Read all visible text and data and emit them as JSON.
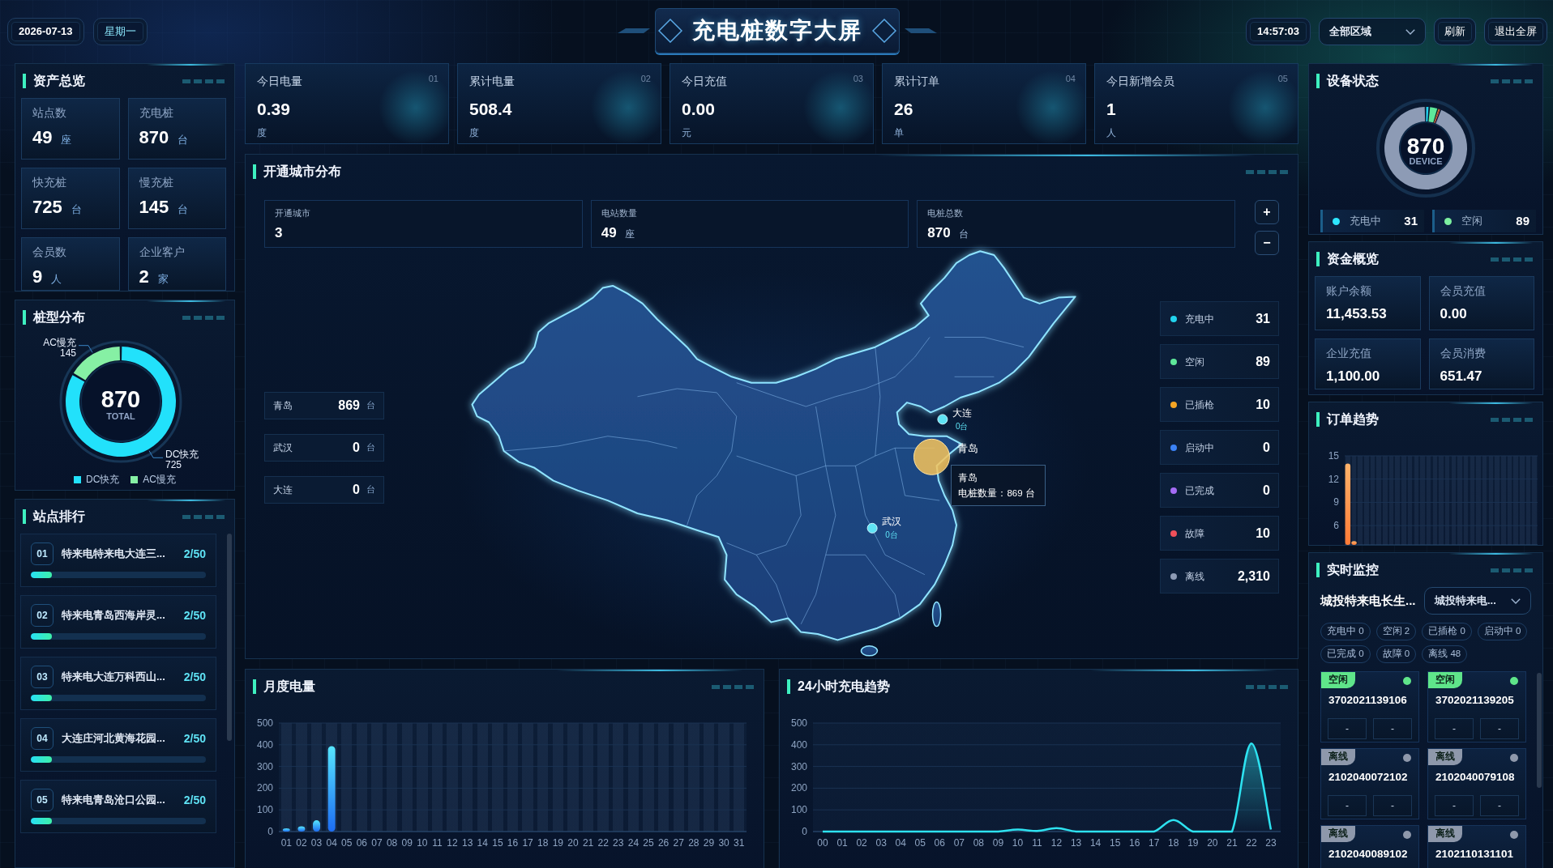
{
  "header": {
    "date": "2026-07-13",
    "weekday": "星期一",
    "title": "充电桩数字大屏",
    "time": "14:57:03",
    "region_select": "全部区域",
    "buttons": [
      "刷新",
      "退出全屏"
    ]
  },
  "asset_overview": {
    "title": "资产总览",
    "items": [
      {
        "label": "站点数",
        "value": "49",
        "unit": "座"
      },
      {
        "label": "充电桩",
        "value": "870",
        "unit": "台"
      },
      {
        "label": "快充桩",
        "value": "725",
        "unit": "台"
      },
      {
        "label": "慢充桩",
        "value": "145",
        "unit": "台"
      },
      {
        "label": "会员数",
        "value": "9",
        "unit": "人"
      },
      {
        "label": "企业客户",
        "value": "2",
        "unit": "家"
      }
    ]
  },
  "pile_types": {
    "title": "桩型分布",
    "total": "870",
    "total_label": "TOTAL",
    "chart_data": {
      "type": "donut",
      "categories": [
        "DC快充",
        "AC慢充"
      ],
      "values": [
        725,
        145
      ],
      "data_labels": true
    },
    "legend": [
      {
        "name": "DC快充",
        "color": "#22e1fb"
      },
      {
        "name": "AC慢充",
        "color": "#86f0a4"
      }
    ]
  },
  "station_ranking": {
    "title": "站点排行",
    "items": [
      {
        "rank": "01",
        "name": "特来电特来电大连三...",
        "value": "2/50",
        "level": 0.12
      },
      {
        "rank": "02",
        "name": "特来电青岛西海岸灵...",
        "value": "2/50",
        "level": 0.12
      },
      {
        "rank": "03",
        "name": "特来电大连万科西山...",
        "value": "2/50",
        "level": 0.12
      },
      {
        "rank": "04",
        "name": "大连庄河北黄海花园...",
        "value": "2/50",
        "level": 0.12
      },
      {
        "rank": "05",
        "name": "特来电青岛沧口公园...",
        "value": "2/50",
        "level": 0.12
      }
    ]
  },
  "kpis": [
    {
      "label": "今日电量",
      "index": "01",
      "value": "0.39",
      "unit": "度"
    },
    {
      "label": "累计电量",
      "index": "02",
      "value": "508.4",
      "unit": "度"
    },
    {
      "label": "今日充值",
      "index": "03",
      "value": "0.00",
      "unit": "元"
    },
    {
      "label": "累计订单",
      "index": "04",
      "value": "26",
      "unit": "单"
    },
    {
      "label": "今日新增会员",
      "index": "05",
      "value": "1",
      "unit": "人"
    }
  ],
  "city_map": {
    "title": "开通城市分布",
    "stats": [
      {
        "label": "开通城市",
        "value": "3"
      },
      {
        "label": "电站数量",
        "value": "49",
        "unit": "座"
      },
      {
        "label": "电桩总数",
        "value": "870",
        "unit": "台"
      }
    ],
    "zoom_buttons": [
      "+",
      "−"
    ],
    "city_list": [
      {
        "city": "青岛",
        "value": "869",
        "unit": "台"
      },
      {
        "city": "武汉",
        "value": "0",
        "unit": "台"
      },
      {
        "city": "大连",
        "value": "0",
        "unit": "台"
      }
    ],
    "markers": [
      {
        "city": "大连",
        "count": "0台",
        "selected": false
      },
      {
        "city": "青岛",
        "selected": true
      },
      {
        "city": "武汉",
        "count": "0台",
        "selected": false
      }
    ],
    "tooltip": {
      "title": "青岛",
      "text": "电桩数量：869 台"
    },
    "status_legend": [
      {
        "label": "充电中",
        "value": "31",
        "color": "#22d3ee"
      },
      {
        "label": "空闲",
        "value": "89",
        "color": "#5ee89a"
      },
      {
        "label": "已插枪",
        "value": "10",
        "color": "#f5a524"
      },
      {
        "label": "启动中",
        "value": "0",
        "color": "#3b82f6"
      },
      {
        "label": "已完成",
        "value": "0",
        "color": "#a56cf5"
      },
      {
        "label": "故障",
        "value": "10",
        "color": "#f0505a"
      },
      {
        "label": "离线",
        "value": "2,310",
        "color": "#8d9bb5"
      }
    ]
  },
  "monthly_energy": {
    "title": "月度电量",
    "chart_data": {
      "type": "bar",
      "categories": [
        "01",
        "02",
        "03",
        "04",
        "05",
        "06",
        "07",
        "08",
        "09",
        "10",
        "11",
        "12",
        "13",
        "14",
        "15",
        "16",
        "17",
        "18",
        "19",
        "20",
        "21",
        "22",
        "23",
        "24",
        "25",
        "26",
        "27",
        "28",
        "29",
        "30",
        "31"
      ],
      "values": [
        15,
        24,
        52,
        394,
        0,
        0,
        0,
        0,
        0,
        0,
        0,
        0,
        0,
        0,
        0,
        0,
        0,
        0,
        0,
        0,
        0,
        0,
        0,
        0,
        0,
        0,
        0,
        0,
        0,
        0,
        0
      ],
      "ylim": [
        0,
        500
      ],
      "yticks": [
        0,
        100,
        200,
        300,
        400,
        500
      ],
      "grid": true
    }
  },
  "hourly_trend": {
    "title": "24小时充电趋势",
    "chart_data": {
      "type": "area",
      "categories": [
        "00",
        "01",
        "02",
        "03",
        "04",
        "05",
        "06",
        "07",
        "08",
        "09",
        "10",
        "11",
        "12",
        "13",
        "14",
        "15",
        "16",
        "17",
        "18",
        "19",
        "20",
        "21",
        "22",
        "23"
      ],
      "values": [
        0,
        0,
        0,
        0,
        0,
        0,
        0,
        0,
        0,
        0,
        9,
        3,
        16,
        0,
        0,
        0,
        0,
        0,
        53,
        0,
        0,
        0,
        406,
        9
      ],
      "ylim": [
        0,
        500
      ],
      "yticks": [
        0,
        100,
        200,
        300,
        400,
        500
      ],
      "grid": true
    }
  },
  "device_status": {
    "title": "设备状态",
    "total": "870",
    "total_label": "DEVICE",
    "legend": [
      {
        "label": "充电中",
        "value": "31",
        "color": "#2ee6ff"
      },
      {
        "label": "空闲",
        "value": "89",
        "color": "#7cf0a0"
      }
    ]
  },
  "funds": {
    "title": "资金概览",
    "items": [
      {
        "label": "账户余额",
        "value": "11,453.53"
      },
      {
        "label": "会员充值",
        "value": "0.00"
      },
      {
        "label": "企业充值",
        "value": "1,100.00"
      },
      {
        "label": "会员消费",
        "value": "651.47"
      }
    ]
  },
  "order_trend": {
    "title": "订单趋势",
    "chart_data": {
      "type": "bar",
      "values": [
        14,
        4,
        null,
        null,
        null,
        null,
        null,
        null,
        null,
        null,
        null,
        null,
        null,
        null,
        null,
        null,
        null,
        null,
        null,
        null,
        null,
        null,
        null,
        null,
        null,
        null,
        null,
        null,
        null,
        null,
        null
      ],
      "ylim": [
        3.5,
        15
      ],
      "yticks": [
        6,
        9,
        12,
        15
      ],
      "grid": true
    }
  },
  "live_monitor": {
    "title": "实时监控",
    "station": "城投特来电长生...",
    "station_select": "城投特来电...",
    "status_chips": [
      "充电中 0",
      "空闲 2",
      "已插枪 0",
      "启动中 0",
      "已完成 0",
      "故障 0",
      "离线 48"
    ],
    "devices": [
      {
        "status": "空闲",
        "color": "#5fe58a",
        "id": "3702021139106",
        "slots": [
          "-",
          "-"
        ]
      },
      {
        "status": "空闲",
        "color": "#5fe58a",
        "id": "3702021139205",
        "slots": [
          "-",
          "-"
        ]
      },
      {
        "status": "离线",
        "color": "#8e98ab",
        "id": "2102040072102",
        "slots": [
          "-",
          "-"
        ]
      },
      {
        "status": "离线",
        "color": "#8e98ab",
        "id": "2102040079108",
        "slots": [
          "-",
          "-"
        ]
      },
      {
        "status": "离线",
        "color": "#8e98ab",
        "id": "2102040089102"
      },
      {
        "status": "离线",
        "color": "#8e98ab",
        "id": "2102110131101"
      }
    ]
  }
}
